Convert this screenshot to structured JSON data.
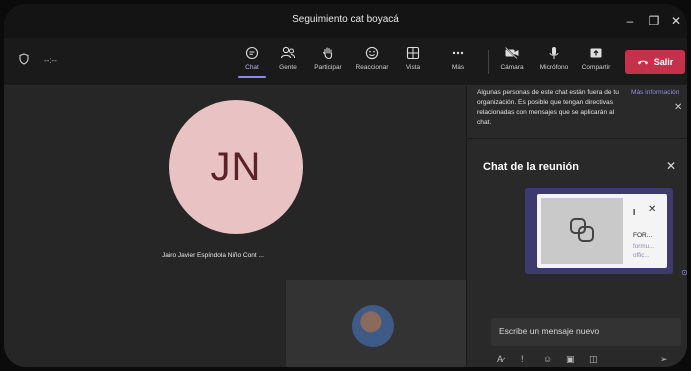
{
  "window": {
    "title": "Seguimiento cat boyacá",
    "min_glyph": "–",
    "max_glyph": "❐",
    "close_glyph": "✕"
  },
  "call": {
    "timer": "--:--"
  },
  "toolbar": {
    "items": [
      {
        "label": "Chat",
        "icon": "chat-icon"
      },
      {
        "label": "Gente",
        "icon": "people-icon"
      },
      {
        "label": "Participar",
        "icon": "raise-hand-icon"
      },
      {
        "label": "Reaccionar",
        "icon": "smile-icon"
      },
      {
        "label": "Vista",
        "icon": "grid-icon"
      },
      {
        "label": "Más",
        "icon": "more-icon"
      },
      {
        "label": "Cámara",
        "icon": "camera-off-icon"
      },
      {
        "label": "Micrófono",
        "icon": "mic-icon"
      },
      {
        "label": "Compartir",
        "icon": "share-icon"
      }
    ],
    "leave_label": "Salir"
  },
  "stage": {
    "initials": "JN",
    "participant_name": "Jairo Javier Espíndola Niño   Cont ..."
  },
  "notice": {
    "text": "Algunas personas de este chat están fuera de tu organización. Es posible que tengan directivas relacionadas con mensajes que se aplicarán al chat.",
    "link": "Más información"
  },
  "chat": {
    "title": "Chat de la reunión",
    "card_letter": "I",
    "card_title": "FOR...",
    "card_subtitle": "formu... offic...",
    "compose_placeholder": "Escribe un mensaje nuevo"
  },
  "colors": {
    "accent": "#8b87f0",
    "leave": "#c4314b",
    "avatar_bg": "#e9c3c4",
    "avatar_fg": "#5a2328",
    "bubble": "#3d3b6e"
  }
}
